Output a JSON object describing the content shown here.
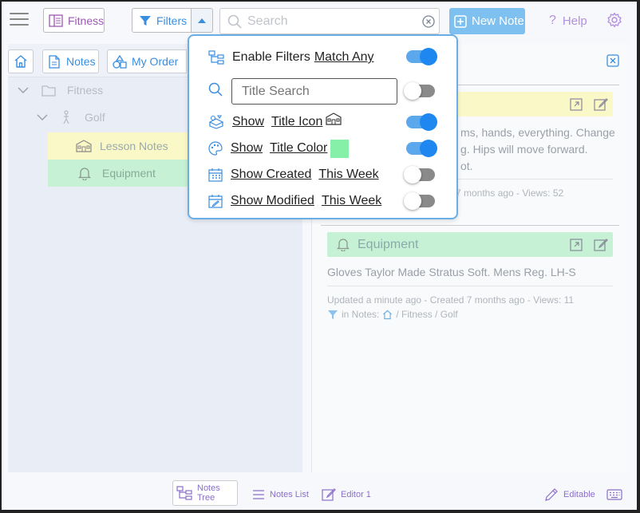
{
  "topbar": {
    "notebook_label": "Fitness",
    "filters_label": "Filters",
    "search_placeholder": "Search",
    "new_note_label": "New Note",
    "help_label": "Help"
  },
  "left_toolbar": {
    "notes_label": "Notes",
    "order_label": "My Order"
  },
  "tree": {
    "fitness": "Fitness",
    "golf": "Golf",
    "lesson_notes": "Lesson Notes",
    "equipment": "Equipment"
  },
  "filters_popup": {
    "enable_label": "Enable Filters",
    "match_label": "Match Any",
    "title_search_placeholder": "Title Search",
    "show_label": "Show",
    "title_icon_label": "Title Icon",
    "title_color_label": "Title Color",
    "show_created_label": "Show Created",
    "show_modified_label": "Show Modified",
    "this_week_label": "This Week",
    "title_color_swatch": "#86f0a8",
    "toggles": {
      "enable": true,
      "title_search": false,
      "title_icon": true,
      "title_color": true,
      "show_created": false,
      "show_modified": false
    }
  },
  "notes_list": {
    "note1": {
      "text_line1": "ms, hands, everything. Change",
      "text_line2": "g. Hips will move forward.",
      "text_line3": "ot.",
      "meta": "7 months ago - Views: 52"
    },
    "note2": {
      "title": "Equipment",
      "text": "Gloves Taylor Made Stratus Soft. Mens Reg. LH-S",
      "meta": "Updated a minute ago - Created 7 months ago - Views: 11",
      "in_notes_label": "in Notes:",
      "path": "/ Fitness / Golf"
    }
  },
  "bottombar": {
    "notes_tree": "Notes Tree",
    "notes_list": "Notes List",
    "editor": "Editor 1",
    "editable": "Editable"
  },
  "colors": {
    "accent_blue": "#1e88f0",
    "purple": "#9b59b6",
    "lesson_yellow": "#fbf8c8",
    "equipment_green": "#c6f1d5"
  }
}
